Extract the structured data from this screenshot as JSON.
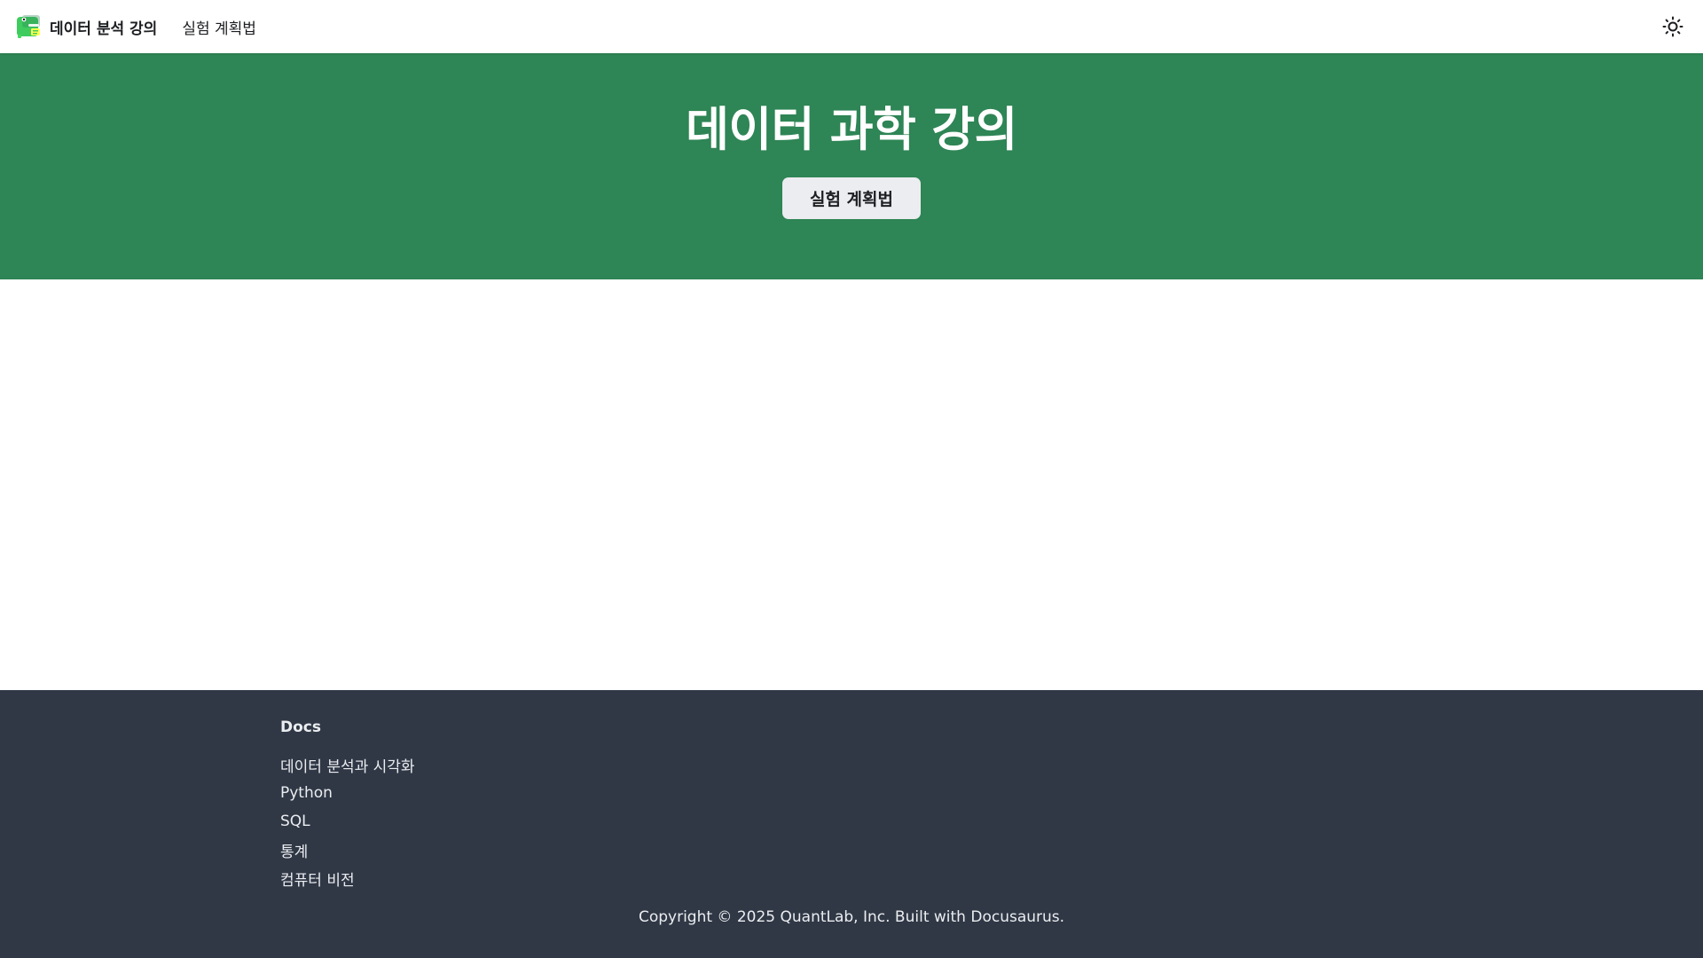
{
  "navbar": {
    "brand_title": "데이터 분석 강의",
    "links": [
      {
        "label": "실험 계획법"
      }
    ],
    "theme_toggle_icon": "sun-icon"
  },
  "hero": {
    "title": "데이터 과학 강의",
    "button_label": "실험 계획법",
    "background_color": "#2e8555"
  },
  "footer": {
    "background_color": "#303846",
    "column_title": "Docs",
    "links": [
      {
        "label": "데이터 분석과 시각화"
      },
      {
        "label": "Python"
      },
      {
        "label": "SQL"
      },
      {
        "label": "통계"
      },
      {
        "label": "컴퓨터 비전"
      }
    ],
    "copyright": "Copyright © 2025 QuantLab, Inc. Built with Docusaurus."
  }
}
